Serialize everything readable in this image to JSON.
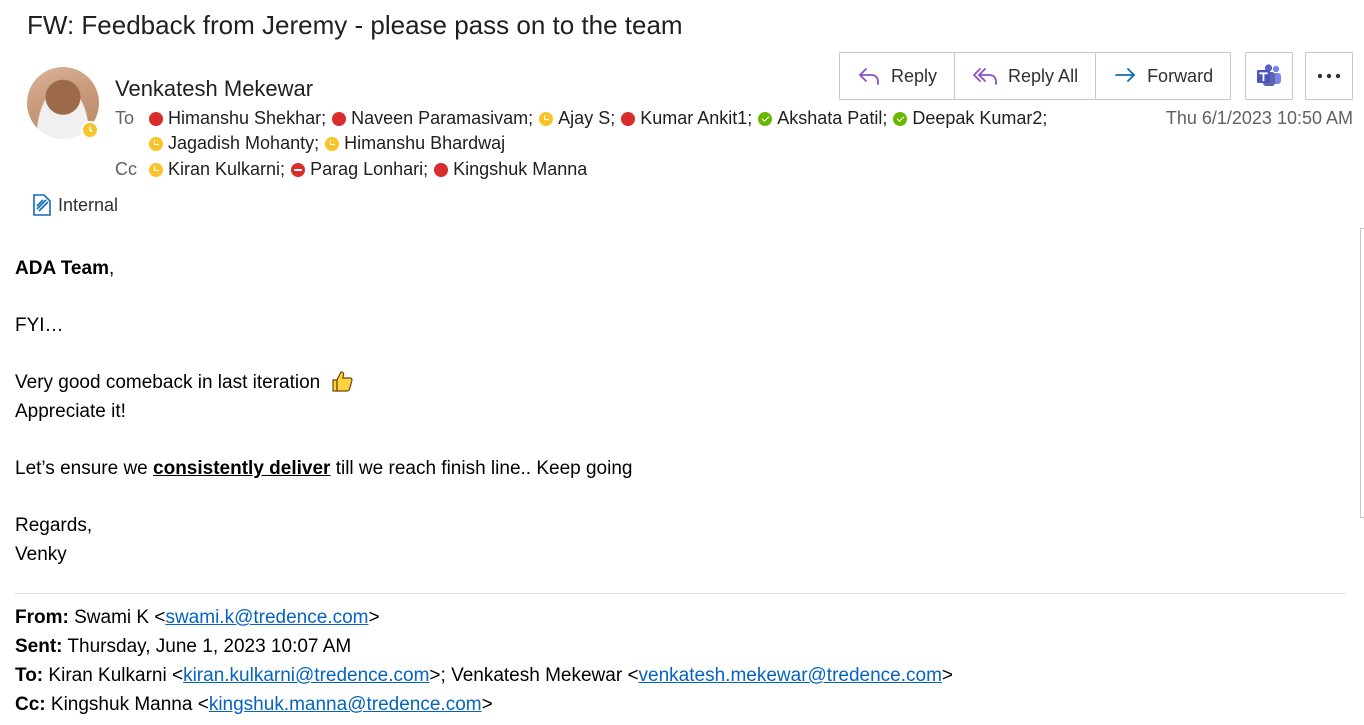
{
  "email": {
    "subject": "FW: Feedback from Jeremy - please pass on to the team",
    "sender": "Venkatesh Mekewar",
    "timestamp": "Thu 6/1/2023 10:50 AM",
    "to_label": "To",
    "cc_label": "Cc",
    "to_line1": [
      {
        "name": "Himanshu Shekhar;",
        "status": "busy"
      },
      {
        "name": "Naveen Paramasivam;",
        "status": "busy"
      },
      {
        "name": "Ajay S;",
        "status": "away"
      },
      {
        "name": "Kumar Ankit1;",
        "status": "busy"
      },
      {
        "name": "Akshata Patil;",
        "status": "available"
      },
      {
        "name": "Deepak Kumar2;",
        "status": "available"
      }
    ],
    "to_line2": [
      {
        "name": "Jagadish Mohanty;",
        "status": "away"
      },
      {
        "name": "Himanshu Bhardwaj",
        "status": "away"
      }
    ],
    "cc": [
      {
        "name": "Kiran Kulkarni;",
        "status": "away"
      },
      {
        "name": "Parag Lonhari;",
        "status": "dnd"
      },
      {
        "name": "Kingshuk Manna",
        "status": "busy"
      }
    ],
    "sensitivity_label": "Internal"
  },
  "toolbar": {
    "reply_label": "Reply",
    "reply_all_label": "Reply All",
    "forward_label": "Forward"
  },
  "body": {
    "greeting": "ADA Team",
    "greeting_punct": ",",
    "fyi": "FYI…",
    "line_comeback": "Very good comeback in last iteration",
    "line_appreciate": "Appreciate it!",
    "line_ensure_pre": "Let’s ensure we ",
    "line_ensure_emph": "consistently deliver",
    "line_ensure_post": " till we reach finish line.. Keep going",
    "regards": "Regards,",
    "signature": "Venky"
  },
  "forwarded": {
    "from_key": "From:",
    "from_name": " Swami K <",
    "from_email": "swami.k@tredence.com",
    "from_close": ">",
    "sent_key": "Sent:",
    "sent_value": " Thursday, June 1, 2023 10:07 AM",
    "to_key": "To:",
    "to_name1": " Kiran Kulkarni <",
    "to_email1": "kiran.kulkarni@tredence.com",
    "to_sep": ">; Venkatesh Mekewar <",
    "to_email2": "venkatesh.mekewar@tredence.com",
    "to_close": ">",
    "cc_key": "Cc:",
    "cc_name": " Kingshuk Manna <",
    "cc_email": "kingshuk.manna@tredence.com",
    "cc_close": ">"
  },
  "colors": {
    "busy": "#d92c2c",
    "away": "#f8c42a",
    "available": "#6bb700",
    "link": "#0563c1",
    "reply_icon": "#8e4ec6",
    "forward_icon": "#0f6cbd",
    "teams": "#5b5fc7"
  }
}
